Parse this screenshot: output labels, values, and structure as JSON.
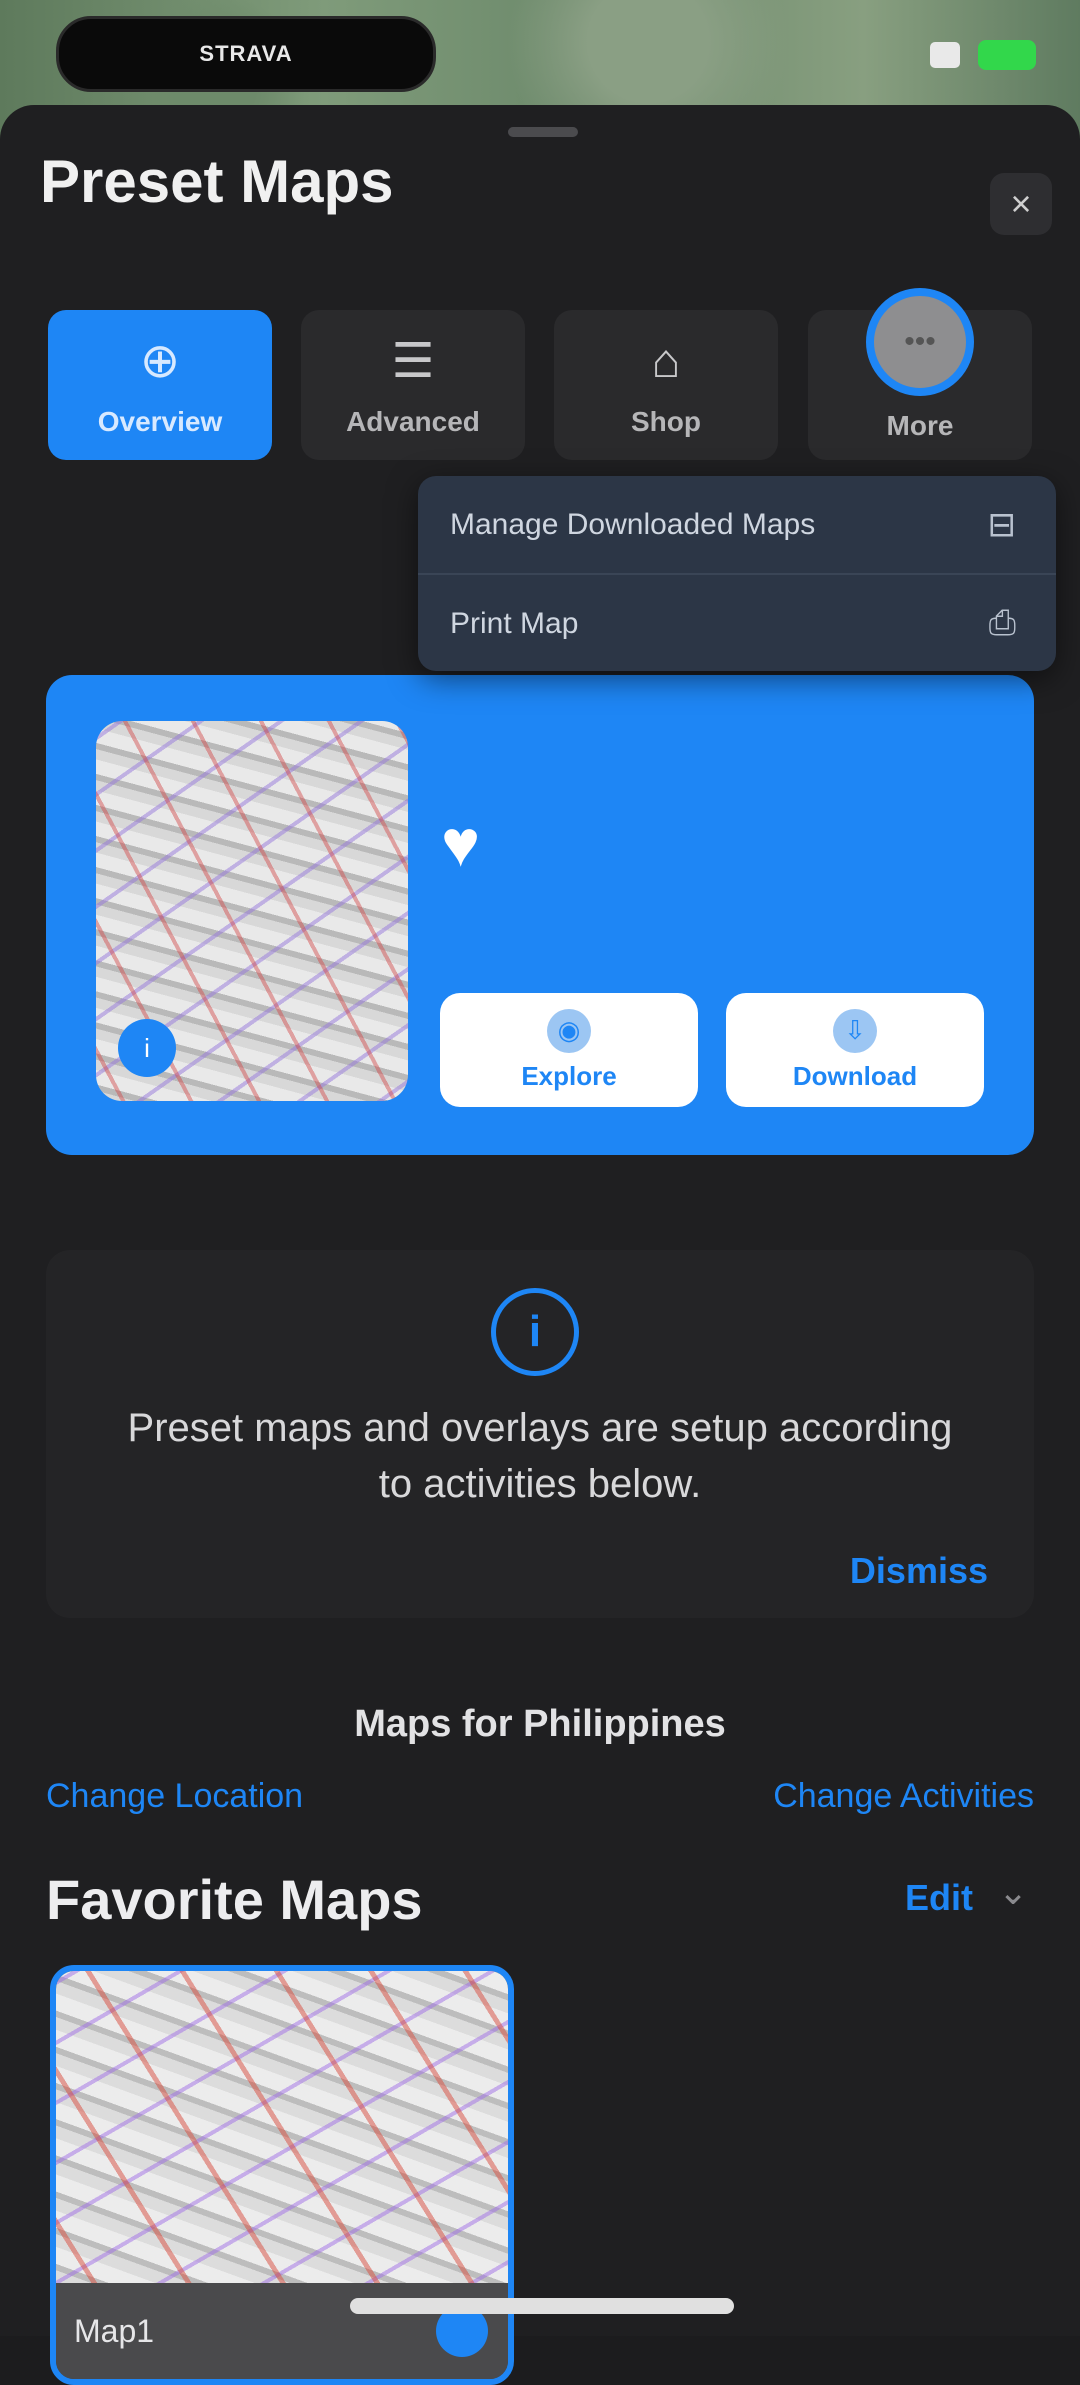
{
  "status_bar": {
    "pill_text": "STRAVA",
    "battery_color": "#32d74b"
  },
  "sheet": {
    "title": "Preset Maps",
    "close_icon": "×"
  },
  "tabs": [
    {
      "label": "Overview",
      "icon": "⊕",
      "active": true
    },
    {
      "label": "Advanced",
      "icon": "☰",
      "active": false
    },
    {
      "label": "Shop",
      "icon": "⌂",
      "active": false
    },
    {
      "label": "More",
      "icon": "•••",
      "active": false
    }
  ],
  "context_menu": {
    "items": [
      {
        "label": "Manage Downloaded Maps",
        "icon": "⊟"
      },
      {
        "label": "Print Map",
        "icon": "⎙"
      }
    ]
  },
  "hero": {
    "badge": "i",
    "heart_icon": "♥",
    "buttons": [
      {
        "label": "Explore",
        "icon": "◉"
      },
      {
        "label": "Download",
        "icon": "⇩"
      }
    ]
  },
  "info_card": {
    "icon": "i",
    "text": "Preset maps and overlays are setup according to activities below.",
    "dismiss_label": "Dismiss"
  },
  "location": {
    "heading": "Maps for Philippines",
    "change_location": "Change Location",
    "change_activities": "Change Activities"
  },
  "favorites": {
    "title": "Favorite Maps",
    "edit_label": "Edit",
    "chevron": "⌄",
    "items": [
      {
        "name": "Map1"
      }
    ]
  },
  "colors": {
    "accent": "#1e86f5",
    "sheet_bg": "#1f1f21",
    "card_bg": "#242426"
  }
}
